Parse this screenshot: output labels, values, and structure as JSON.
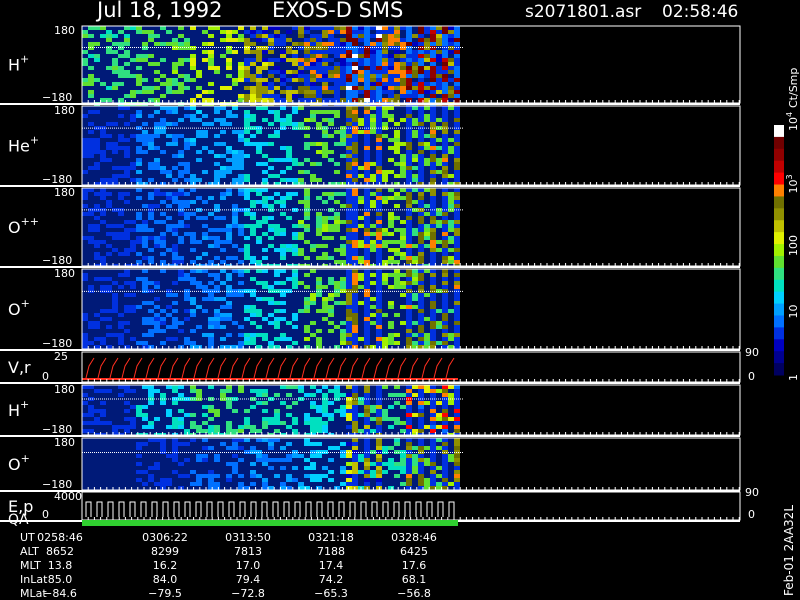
{
  "header": {
    "date": "Jul 18, 1992",
    "instrument": "EXOS-D SMS",
    "file": "s2071801.asr",
    "time": "02:58:46"
  },
  "chart_data": {
    "type": "heatmap",
    "panels": [
      {
        "species": "H",
        "charge": "+",
        "ytop": "180",
        "ybot": "−180",
        "intensity": [
          0.55,
          0.6,
          0.7,
          0.85,
          0.95,
          0.95,
          0.9
        ]
      },
      {
        "species": "He",
        "charge": "+",
        "ytop": "180",
        "ybot": "−180",
        "intensity": [
          0.2,
          0.3,
          0.35,
          0.45,
          0.6,
          0.65,
          0.6
        ]
      },
      {
        "species": "O",
        "charge": "++",
        "ytop": "180",
        "ybot": "−180",
        "intensity": [
          0.2,
          0.25,
          0.3,
          0.45,
          0.6,
          0.65,
          0.6
        ]
      },
      {
        "species": "O",
        "charge": "+",
        "ytop": "180",
        "ybot": "−180",
        "intensity": [
          0.2,
          0.25,
          0.3,
          0.45,
          0.6,
          0.65,
          0.6
        ]
      },
      {
        "species": "V,r",
        "charge": "",
        "ytop": "25",
        "ybot": "0",
        "right_top": "90",
        "right_bot": "0"
      },
      {
        "species": "H",
        "charge": "+",
        "ytop": "180",
        "ybot": "−180",
        "intensity": [
          0.2,
          0.45,
          0.55,
          0.5,
          0.45,
          0.55,
          0.7
        ]
      },
      {
        "species": "O",
        "charge": "+",
        "ytop": "180",
        "ybot": "−180",
        "intensity": [
          0.15,
          0.2,
          0.25,
          0.3,
          0.4,
          0.5,
          0.6
        ]
      },
      {
        "species": "E,p",
        "charge": "",
        "ytop": "4000",
        "ybot": "0",
        "right_top": "90",
        "right_bot": "0"
      }
    ],
    "qa_label": "QA",
    "colorbar": {
      "title": "Ct/Smp",
      "ticks": [
        {
          "label": "1",
          "value": 1
        },
        {
          "label": "10",
          "value": 10
        },
        {
          "label": "100",
          "value": 100
        },
        {
          "label": "10",
          "exp": "3",
          "value": 1000
        },
        {
          "label": "10",
          "exp": "4",
          "value": 10000
        }
      ],
      "colors": [
        "#000060",
        "#000090",
        "#0000c0",
        "#0030e0",
        "#0070ff",
        "#00a0ff",
        "#00d0ff",
        "#00e0c0",
        "#30e080",
        "#60e030",
        "#a0f000",
        "#e0f000",
        "#c0c000",
        "#909000",
        "#707000",
        "#ff8000",
        "#ff0000",
        "#c00000",
        "#900000",
        "#700000",
        "#ffffff"
      ]
    },
    "ephemeris": {
      "labels": [
        "UT",
        "ALT",
        "MLT",
        "InLat",
        "MLat"
      ],
      "columns": [
        [
          "0258:46",
          "8652",
          "13.8",
          "85.0",
          "−84.6"
        ],
        [
          "0306:22",
          "8299",
          "16.2",
          "84.0",
          "−79.5"
        ],
        [
          "0313:50",
          "7813",
          "17.0",
          "79.4",
          "−72.8"
        ],
        [
          "0321:18",
          "7188",
          "17.4",
          "74.2",
          "−65.3"
        ],
        [
          "0328:46",
          "6425",
          "17.6",
          "68.1",
          "−56.8"
        ]
      ]
    },
    "footer_id": "Feb-01 2AA32L"
  }
}
